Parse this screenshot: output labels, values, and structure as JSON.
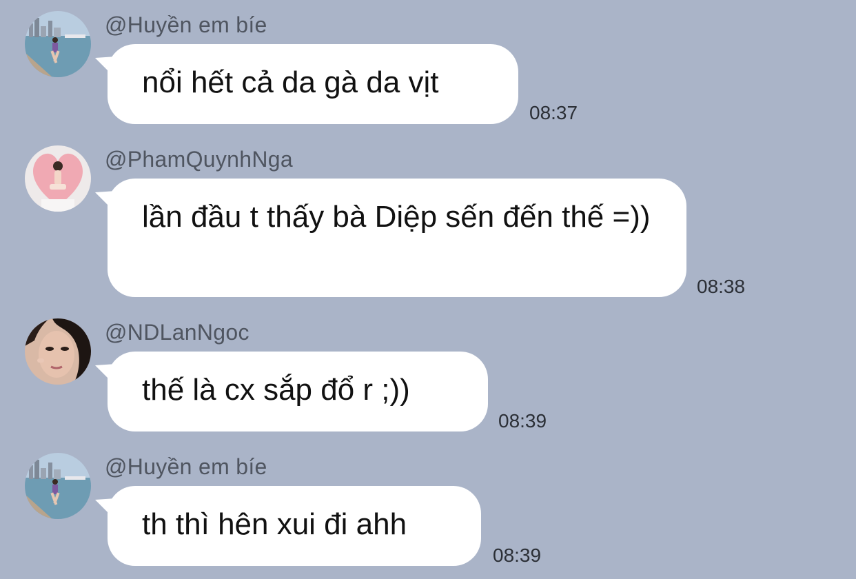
{
  "messages": [
    {
      "sender": "@Huyền em bíe",
      "text": "nổi hết cả da gà da vịt",
      "time": "08:37",
      "avatar_icon": "city-harbor-avatar"
    },
    {
      "sender": "@PhamQuynhNga",
      "text": "lần đầu t thấy bà Diệp sến đến thế =))",
      "time": "08:38",
      "avatar_icon": "heart-portrait-avatar"
    },
    {
      "sender": "@NDLanNgoc",
      "text": "thế là cx sắp đổ r ;))",
      "time": "08:39",
      "avatar_icon": "portrait-avatar"
    },
    {
      "sender": "@Huyền em bíe",
      "text": "th thì hên xui đi ahh",
      "time": "08:39",
      "avatar_icon": "city-harbor-avatar"
    }
  ],
  "colors": {
    "background": "#aab4c8",
    "bubble": "#ffffff",
    "sender": "#4f5560",
    "text": "#111111",
    "time": "#2b2f36"
  }
}
